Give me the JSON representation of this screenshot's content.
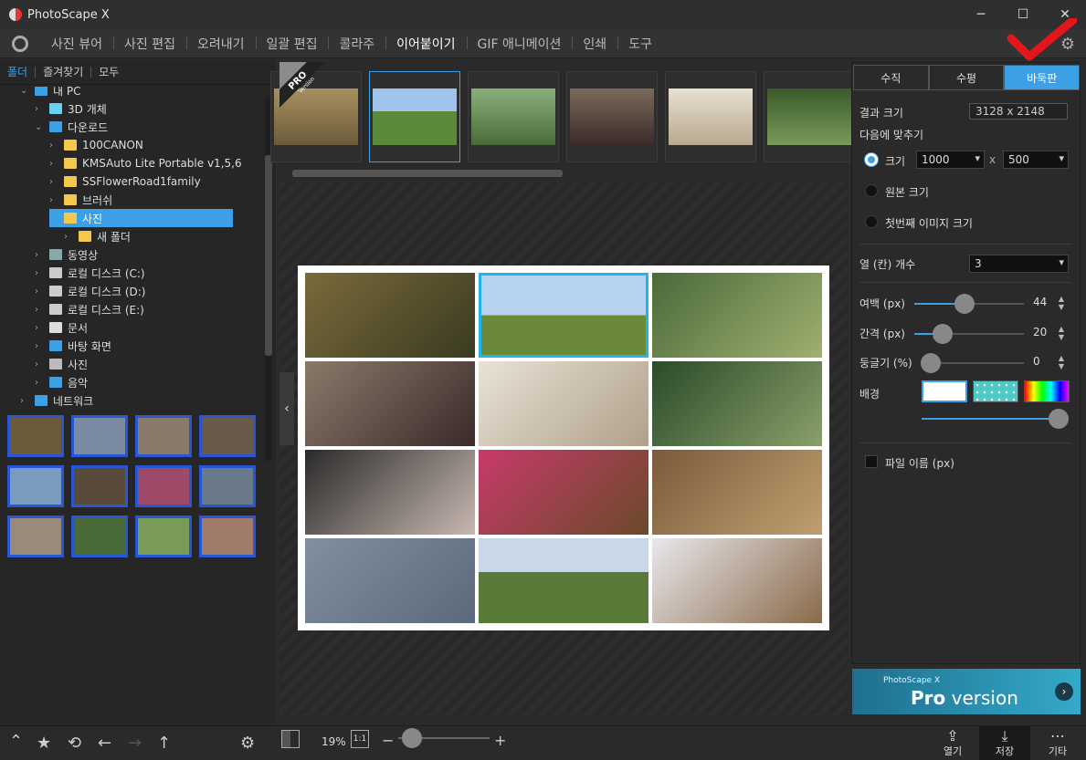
{
  "app": {
    "title": "PhotoScape X"
  },
  "window_controls": {
    "minimize": "─",
    "maximize": "☐",
    "close": "✕"
  },
  "menu": [
    "사진 뷰어",
    "사진 편집",
    "오려내기",
    "일괄 편집",
    "콜라주",
    "이어붙이기",
    "GIF 애니메이션",
    "인쇄",
    "도구"
  ],
  "menu_active_index": 5,
  "left_tabs": [
    "폴더",
    "즐겨찾기",
    "모두"
  ],
  "tree": [
    {
      "label": "내 PC",
      "indent": 0,
      "icon": "pc-icon"
    },
    {
      "label": "3D 개체",
      "indent": 1,
      "icon": "3d-icon"
    },
    {
      "label": "다운로드",
      "indent": 1,
      "icon": "download-icon"
    },
    {
      "label": "100CANON",
      "indent": 2,
      "icon": "folder-icon"
    },
    {
      "label": "KMSAuto Lite Portable v1,5,6",
      "indent": 2,
      "icon": "folder-icon"
    },
    {
      "label": "SSFlowerRoad1family",
      "indent": 2,
      "icon": "folder-icon"
    },
    {
      "label": "브러쉬",
      "indent": 2,
      "icon": "folder-icon"
    },
    {
      "label": "사진",
      "indent": 2,
      "icon": "folder-icon",
      "selected": true
    },
    {
      "label": "새 폴더",
      "indent": 3,
      "icon": "folder-icon"
    },
    {
      "label": "동영상",
      "indent": 1,
      "icon": "video-icon"
    },
    {
      "label": "로컬 디스크 (C:)",
      "indent": 1,
      "icon": "disk-icon"
    },
    {
      "label": "로컬 디스크 (D:)",
      "indent": 1,
      "icon": "disk-icon"
    },
    {
      "label": "로컬 디스크 (E:)",
      "indent": 1,
      "icon": "disk-icon"
    },
    {
      "label": "문서",
      "indent": 1,
      "icon": "document-icon"
    },
    {
      "label": "바탕 화면",
      "indent": 1,
      "icon": "desktop-icon"
    },
    {
      "label": "사진",
      "indent": 1,
      "icon": "pictures-icon"
    },
    {
      "label": "음악",
      "indent": 1,
      "icon": "music-icon"
    },
    {
      "label": "네트워크",
      "indent": 0,
      "icon": "network-icon"
    }
  ],
  "strip": {
    "pro_badge": "PRO",
    "pro_sub": "Version"
  },
  "right": {
    "tabs": [
      "수직",
      "수평",
      "바둑판"
    ],
    "active_tab": 2,
    "result_size_label": "결과 크기",
    "result_size_value": "3128 x 2148",
    "fit_label": "다음에 맞추기",
    "size_label": "크기",
    "width_value": "1000",
    "times": "x",
    "height_value": "500",
    "original_size": "원본 크기",
    "first_image_size": "첫번째 이미지 크기",
    "columns_label": "열 (칸) 개수",
    "columns_value": "3",
    "margin_label": "여백 (px)",
    "margin_value": "44",
    "spacing_label": "간격 (px)",
    "spacing_value": "20",
    "round_label": "둥글기 (%)",
    "round_value": "0",
    "background_label": "배경",
    "filename_label": "파일 이름 (px)"
  },
  "pro_banner": {
    "small": "PhotoScape X",
    "pro": "Pro",
    "version": "version",
    "arrow": "›"
  },
  "bottom": {
    "zoom": "19%",
    "one_to_one": "1:1",
    "minus": "−",
    "plus": "+",
    "open": "열기",
    "save": "저장",
    "more": "기타"
  },
  "colors": {
    "accent": "#3ba0e6",
    "thumb_border": "#2857d6",
    "selected_cell": "#1fb6f0"
  }
}
